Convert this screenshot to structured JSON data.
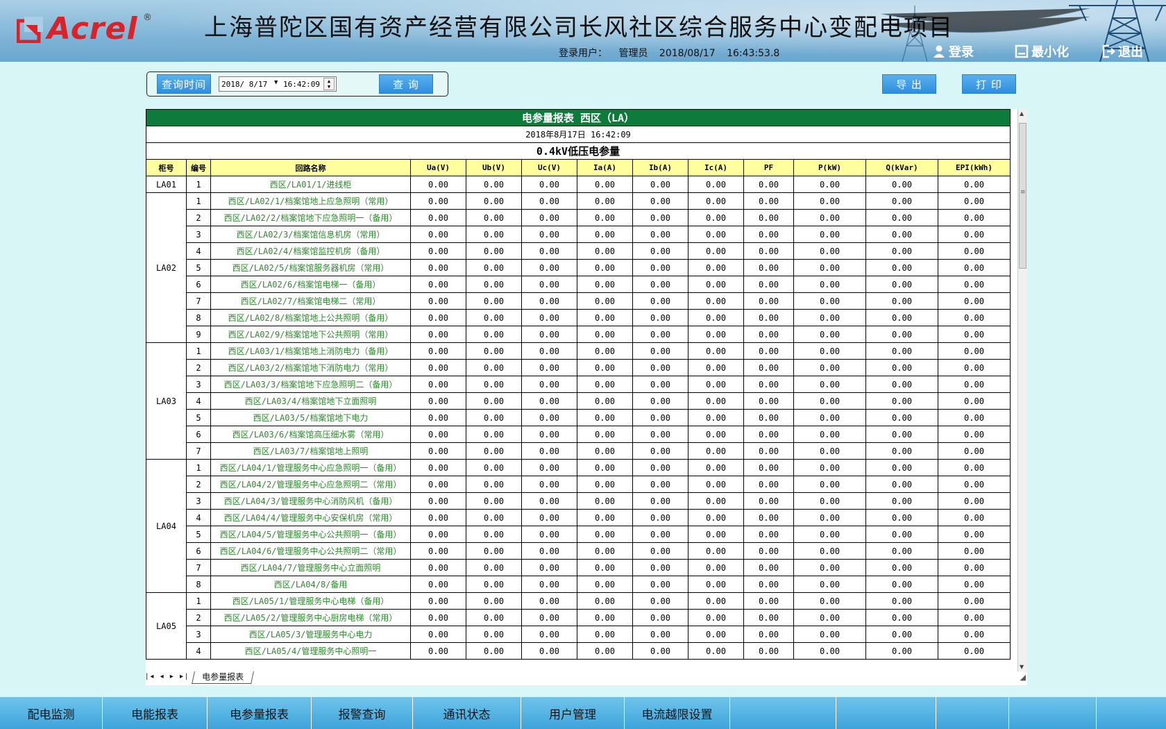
{
  "header": {
    "brand": "Acrel",
    "reg_mark": "®",
    "title": "上海普陀区国有资产经营有限公司长风社区综合服务中心变配电项目",
    "user_label": "登录用户：",
    "user_name": "管理员",
    "date": "2018/08/17",
    "time": "16:43:53.8",
    "login_label": "登录",
    "minimize_label": "最小化",
    "logout_label": "退出"
  },
  "query": {
    "button_label": "查询时间",
    "date_value": "2018/ 8/17",
    "time_value": "16:42:09",
    "search_label": "查 询",
    "export_label": "导 出",
    "print_label": "打 印"
  },
  "report": {
    "title": "电参量报表  西区（LA）",
    "datetime": "2018年8月17日  16:42:09",
    "subtitle": "0.4kV低压电参量",
    "columns": [
      "柜号",
      "编号",
      "回路名称",
      "Ua(V)",
      "Ub(V)",
      "Uc(V)",
      "Ia(A)",
      "Ib(A)",
      "Ic(A)",
      "PF",
      "P(kW)",
      "Q(kVar)",
      "EPI(kWh)"
    ],
    "groups": [
      {
        "cabinet": "LA01",
        "rows": [
          {
            "no": "1",
            "name": "西区/LA01/1/进线柜"
          }
        ]
      },
      {
        "cabinet": "LA02",
        "rows": [
          {
            "no": "1",
            "name": "西区/LA02/1/档案馆地上应急照明（常用）"
          },
          {
            "no": "2",
            "name": "西区/LA02/2/档案馆地下应急照明一（备用）"
          },
          {
            "no": "3",
            "name": "西区/LA02/3/档案馆信息机房（常用）"
          },
          {
            "no": "4",
            "name": "西区/LA02/4/档案馆监控机房（备用）"
          },
          {
            "no": "5",
            "name": "西区/LA02/5/档案馆服务器机房（常用）"
          },
          {
            "no": "6",
            "name": "西区/LA02/6/档案馆电梯一（备用）"
          },
          {
            "no": "7",
            "name": "西区/LA02/7/档案馆电梯二（常用）"
          },
          {
            "no": "8",
            "name": "西区/LA02/8/档案馆地上公共照明（备用）"
          },
          {
            "no": "9",
            "name": "西区/LA02/9/档案馆地下公共照明（常用）"
          }
        ]
      },
      {
        "cabinet": "LA03",
        "rows": [
          {
            "no": "1",
            "name": "西区/LA03/1/档案馆地上消防电力（备用）"
          },
          {
            "no": "2",
            "name": "西区/LA03/2/档案馆地下消防电力（常用）"
          },
          {
            "no": "3",
            "name": "西区/LA03/3/档案馆地下应急照明二（备用）"
          },
          {
            "no": "4",
            "name": "西区/LA03/4/档案馆地下立面照明"
          },
          {
            "no": "5",
            "name": "西区/LA03/5/档案馆地下电力"
          },
          {
            "no": "6",
            "name": "西区/LA03/6/档案馆高压细水雾（常用）"
          },
          {
            "no": "7",
            "name": "西区/LA03/7/档案馆地上照明"
          }
        ]
      },
      {
        "cabinet": "LA04",
        "rows": [
          {
            "no": "1",
            "name": "西区/LA04/1/管理服务中心应急照明一（备用）"
          },
          {
            "no": "2",
            "name": "西区/LA04/2/管理服务中心应急照明二（常用）"
          },
          {
            "no": "3",
            "name": "西区/LA04/3/管理服务中心消防风机（备用）"
          },
          {
            "no": "4",
            "name": "西区/LA04/4/管理服务中心安保机房（常用）"
          },
          {
            "no": "5",
            "name": "西区/LA04/5/管理服务中心公共照明一（备用）"
          },
          {
            "no": "6",
            "name": "西区/LA04/6/管理服务中心公共照明二（常用）"
          },
          {
            "no": "7",
            "name": "西区/LA04/7/管理服务中心立面照明"
          },
          {
            "no": "8",
            "name": "西区/LA04/8/备用"
          }
        ]
      },
      {
        "cabinet": "LA05",
        "rows": [
          {
            "no": "1",
            "name": "西区/LA05/1/管理服务中心电梯（备用）"
          },
          {
            "no": "2",
            "name": "西区/LA05/2/管理服务中心厨房电梯（常用）"
          },
          {
            "no": "3",
            "name": "西区/LA05/3/管理服务中心电力"
          },
          {
            "no": "4",
            "name": "西区/LA05/4/管理服务中心照明一"
          }
        ]
      }
    ],
    "cell_value": "0.00",
    "sheet_tab": "电参量报表"
  },
  "nav": {
    "items": [
      "配电监测",
      "电能报表",
      "电参量报表",
      "报警查询",
      "通讯状态",
      "用户管理",
      "电流越限设置",
      "",
      "",
      "",
      ""
    ]
  }
}
